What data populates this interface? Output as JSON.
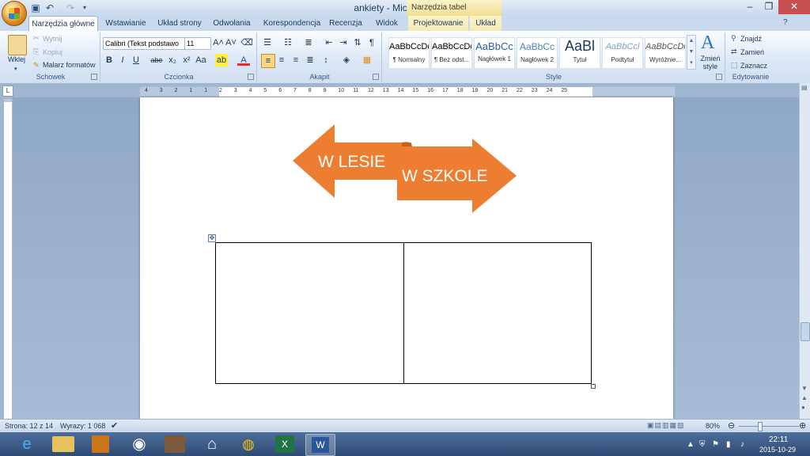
{
  "window": {
    "title": "ankiety - Microsoft Word",
    "context_tab_title": "Narzędzia tabel"
  },
  "quick_access": {
    "icons": [
      "save-icon",
      "undo-icon",
      "redo-icon",
      "customize-icon"
    ]
  },
  "window_controls": {
    "minimize": "–",
    "restore": "❐",
    "close": "✕"
  },
  "tabs": [
    {
      "label": "Narzędzia główne",
      "active": true
    },
    {
      "label": "Wstawianie"
    },
    {
      "label": "Układ strony"
    },
    {
      "label": "Odwołania"
    },
    {
      "label": "Korespondencja"
    },
    {
      "label": "Recenzja"
    },
    {
      "label": "Widok"
    },
    {
      "label": "Projektowanie",
      "contextual": true
    },
    {
      "label": "Układ",
      "contextual": true
    }
  ],
  "ribbon": {
    "clipboard": {
      "group_label": "Schowek",
      "paste_label": "Wklej",
      "cut_label": "Wytnij",
      "copy_label": "Kopiuj",
      "format_painter_label": "Malarz formatów"
    },
    "font": {
      "group_label": "Czcionka",
      "font_name": "Calibri (Tekst podstawo",
      "font_size": "11",
      "bold": "B",
      "italic": "I",
      "underline": "U",
      "strike": "abe",
      "sub": "x₂",
      "sup": "x²",
      "case": "Aa"
    },
    "paragraph": {
      "group_label": "Akapit"
    },
    "styles": {
      "group_label": "Style",
      "items": [
        {
          "preview": "AaBbCcDc",
          "name": "¶ Normalny"
        },
        {
          "preview": "AaBbCcDc",
          "name": "¶ Bez odst..."
        },
        {
          "preview": "AaBbCc",
          "name": "Nagłówek 1"
        },
        {
          "preview": "AaBbCc",
          "name": "Nagłówek 2"
        },
        {
          "preview": "AaBl",
          "name": "Tytuł"
        },
        {
          "preview": "AaBbCcl",
          "name": "Podtytuł"
        },
        {
          "preview": "AaBbCcDc",
          "name": "Wyróżnie..."
        }
      ],
      "change_styles_label": "Zmień style"
    },
    "editing": {
      "group_label": "Edytowanie",
      "find_label": "Znajdź",
      "replace_label": "Zamień",
      "select_label": "Zaznacz"
    }
  },
  "ruler": {
    "numbers": [
      "4",
      "3",
      "2",
      "1",
      "1",
      "2",
      "3",
      "4",
      "5",
      "6",
      "7",
      "8",
      "9",
      "10",
      "11",
      "12",
      "13",
      "14",
      "15",
      "16",
      "17",
      "18",
      "19",
      "20",
      "21",
      "22",
      "23",
      "24",
      "25"
    ]
  },
  "document": {
    "shapes": [
      {
        "text": "W LESIE",
        "direction": "left",
        "color": "#ed7d31"
      },
      {
        "text": "W SZKOLE",
        "direction": "right",
        "color": "#ed7d31"
      }
    ],
    "table": {
      "rows": 1,
      "cols": 2
    }
  },
  "status": {
    "page": "Strona: 12 z 14",
    "words": "Wyrazy: 1 068",
    "zoom": "80%"
  },
  "taskbar": {
    "apps": [
      "ie-icon",
      "file-explorer-icon",
      "media-icon",
      "speaker-icon",
      "docs-app-icon",
      "home-icon",
      "chrome-icon",
      "excel-icon",
      "word-icon"
    ],
    "time": "22:11",
    "date": "2015-10-29"
  },
  "colors": {
    "accent": "#ed7d31",
    "ribbon": "#dbe7f6",
    "taskbar": "#2f4b74"
  }
}
